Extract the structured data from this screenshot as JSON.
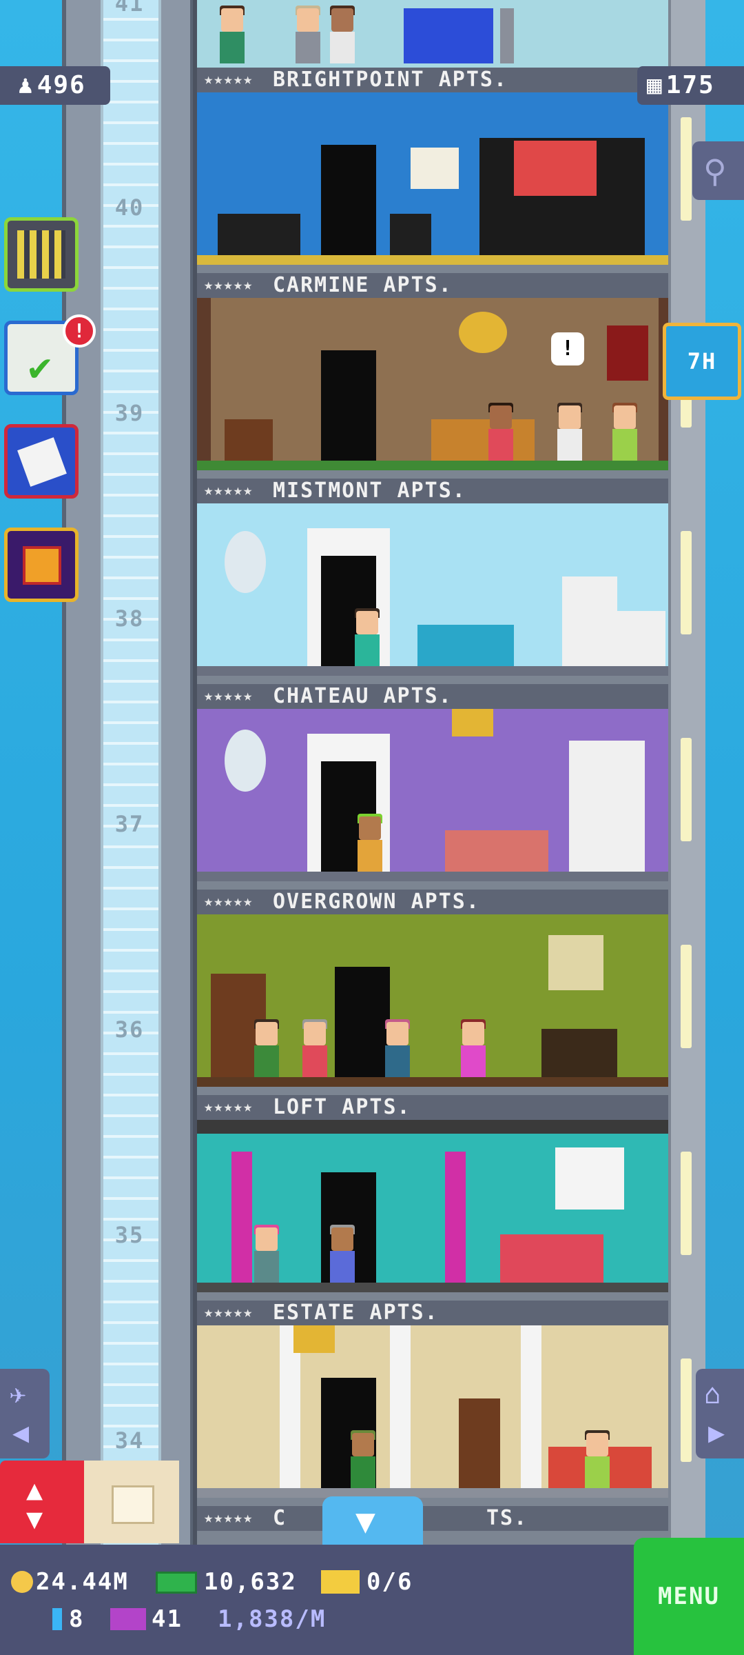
{
  "hud": {
    "population": "496",
    "floor_count": "175",
    "timer_label": "7H",
    "notification_badge": "!"
  },
  "floors": [
    {
      "name": "BRIGHTPOINT APTS.",
      "stars": "★★★★★",
      "number": "40",
      "color": "#2b7fcf"
    },
    {
      "name": "CARMINE APTS.",
      "stars": "★★★★★",
      "number": "39",
      "color": "#6b3b2c"
    },
    {
      "name": "MISTMONT APTS.",
      "stars": "★★★★★",
      "number": "38",
      "color": "#a9e1f3"
    },
    {
      "name": "CHATEAU APTS.",
      "stars": "★★★★★",
      "number": "37",
      "color": "#8e6cc8"
    },
    {
      "name": "OVERGROWN APTS.",
      "stars": "★★★★★",
      "number": "36",
      "color": "#7f9a2e"
    },
    {
      "name": "LOFT APTS.",
      "stars": "★★★★★",
      "number": "35",
      "color": "#2fb9b4"
    },
    {
      "name": "ESTATE APTS.",
      "stars": "★★★★★",
      "number": "34",
      "color": "#e2d3a6"
    }
  ],
  "top_floor_number": "41",
  "bottom_partial_label": "C",
  "bottom_partial_suffix": "TS.",
  "resources": {
    "coins": "24.44M",
    "bux": "10,632",
    "tickets": "0/6",
    "blue_items": "8",
    "vip": "41",
    "income": "1,838/M"
  },
  "menu_label": "MENU"
}
